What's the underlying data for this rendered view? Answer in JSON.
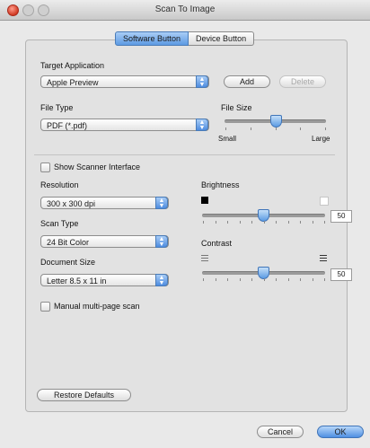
{
  "window": {
    "title": "Scan To Image"
  },
  "tabs": [
    "Software Button",
    "Device Button"
  ],
  "target_application": {
    "label": "Target Application",
    "value": "Apple Preview",
    "add": "Add",
    "delete": "Delete"
  },
  "file_type": {
    "label": "File Type",
    "value": "PDF (*.pdf)"
  },
  "file_size": {
    "label": "File Size",
    "min_label": "Small",
    "max_label": "Large",
    "level": 0.5
  },
  "show_scanner": {
    "label": "Show Scanner Interface",
    "checked": false
  },
  "resolution": {
    "label": "Resolution",
    "value": "300 x 300 dpi"
  },
  "scan_type": {
    "label": "Scan Type",
    "value": "24 Bit Color"
  },
  "document_size": {
    "label": "Document Size",
    "value": "Letter  8.5 x 11 in"
  },
  "manual_multipage": {
    "label": "Manual multi-page scan",
    "checked": false
  },
  "brightness": {
    "label": "Brightness",
    "value": "50"
  },
  "contrast": {
    "label": "Contrast",
    "value": "50"
  },
  "footer": {
    "restore": "Restore Defaults",
    "cancel": "Cancel",
    "ok": "OK"
  }
}
